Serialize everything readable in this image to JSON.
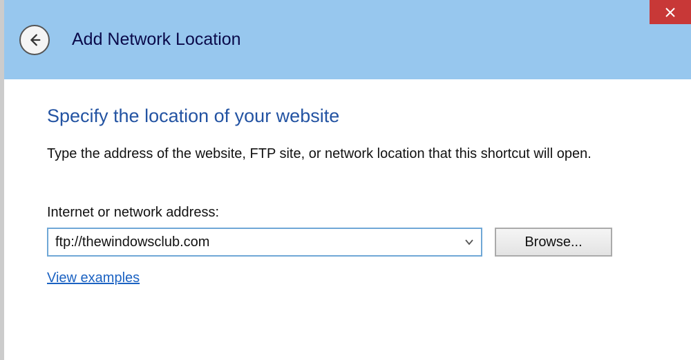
{
  "titlebar": {
    "title": "Add Network Location"
  },
  "content": {
    "heading": "Specify the location of your website",
    "description": "Type the address of the website, FTP site, or network location that this shortcut will open.",
    "field_label": "Internet or network address:",
    "address_value": "ftp://thewindowsclub.com",
    "browse_label": "Browse...",
    "examples_link": "View examples"
  }
}
